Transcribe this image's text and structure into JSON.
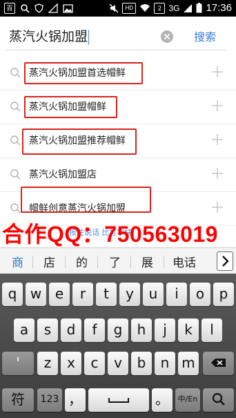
{
  "status_bar": {
    "left_badges": [
      "百",
      "✕",
      "S"
    ],
    "hd": "HD",
    "sim": "2",
    "network": "3G",
    "time": "17:36"
  },
  "search": {
    "query": "蒸汽火锅加盟",
    "submit_label": "搜索"
  },
  "suggestions": [
    {
      "text": "蒸汽火锅加盟首选帽鲜",
      "highlighted": true
    },
    {
      "text": "蒸汽火锅加盟帽鲜",
      "highlighted": true
    },
    {
      "text": "蒸汽火锅加盟推荐帽鲜",
      "highlighted": true
    },
    {
      "text": "蒸汽火锅加盟店",
      "highlighted": false
    },
    {
      "text": "帽鲜创意蒸汽火锅加盟",
      "highlighted": true
    }
  ],
  "overlay": {
    "watermark": "合作QQ：750563019",
    "voice_hint": "按住说话 比打字快"
  },
  "candidates": [
    "商",
    "店",
    "的",
    "了",
    "展",
    "电话"
  ],
  "keyboard": {
    "row1": [
      "q",
      "w",
      "e",
      "r",
      "t",
      "y",
      "u",
      "i",
      "o",
      "p"
    ],
    "row2": [
      "a",
      "s",
      "d",
      "f",
      "g",
      "h",
      "j",
      "k",
      "l"
    ],
    "row3": [
      "'",
      "z",
      "x",
      "c",
      "v",
      "b",
      "n",
      "m"
    ],
    "row4": {
      "symbol": "符",
      "num": "123",
      "comma": "，",
      "period": "。",
      "lang": "中/En"
    }
  }
}
